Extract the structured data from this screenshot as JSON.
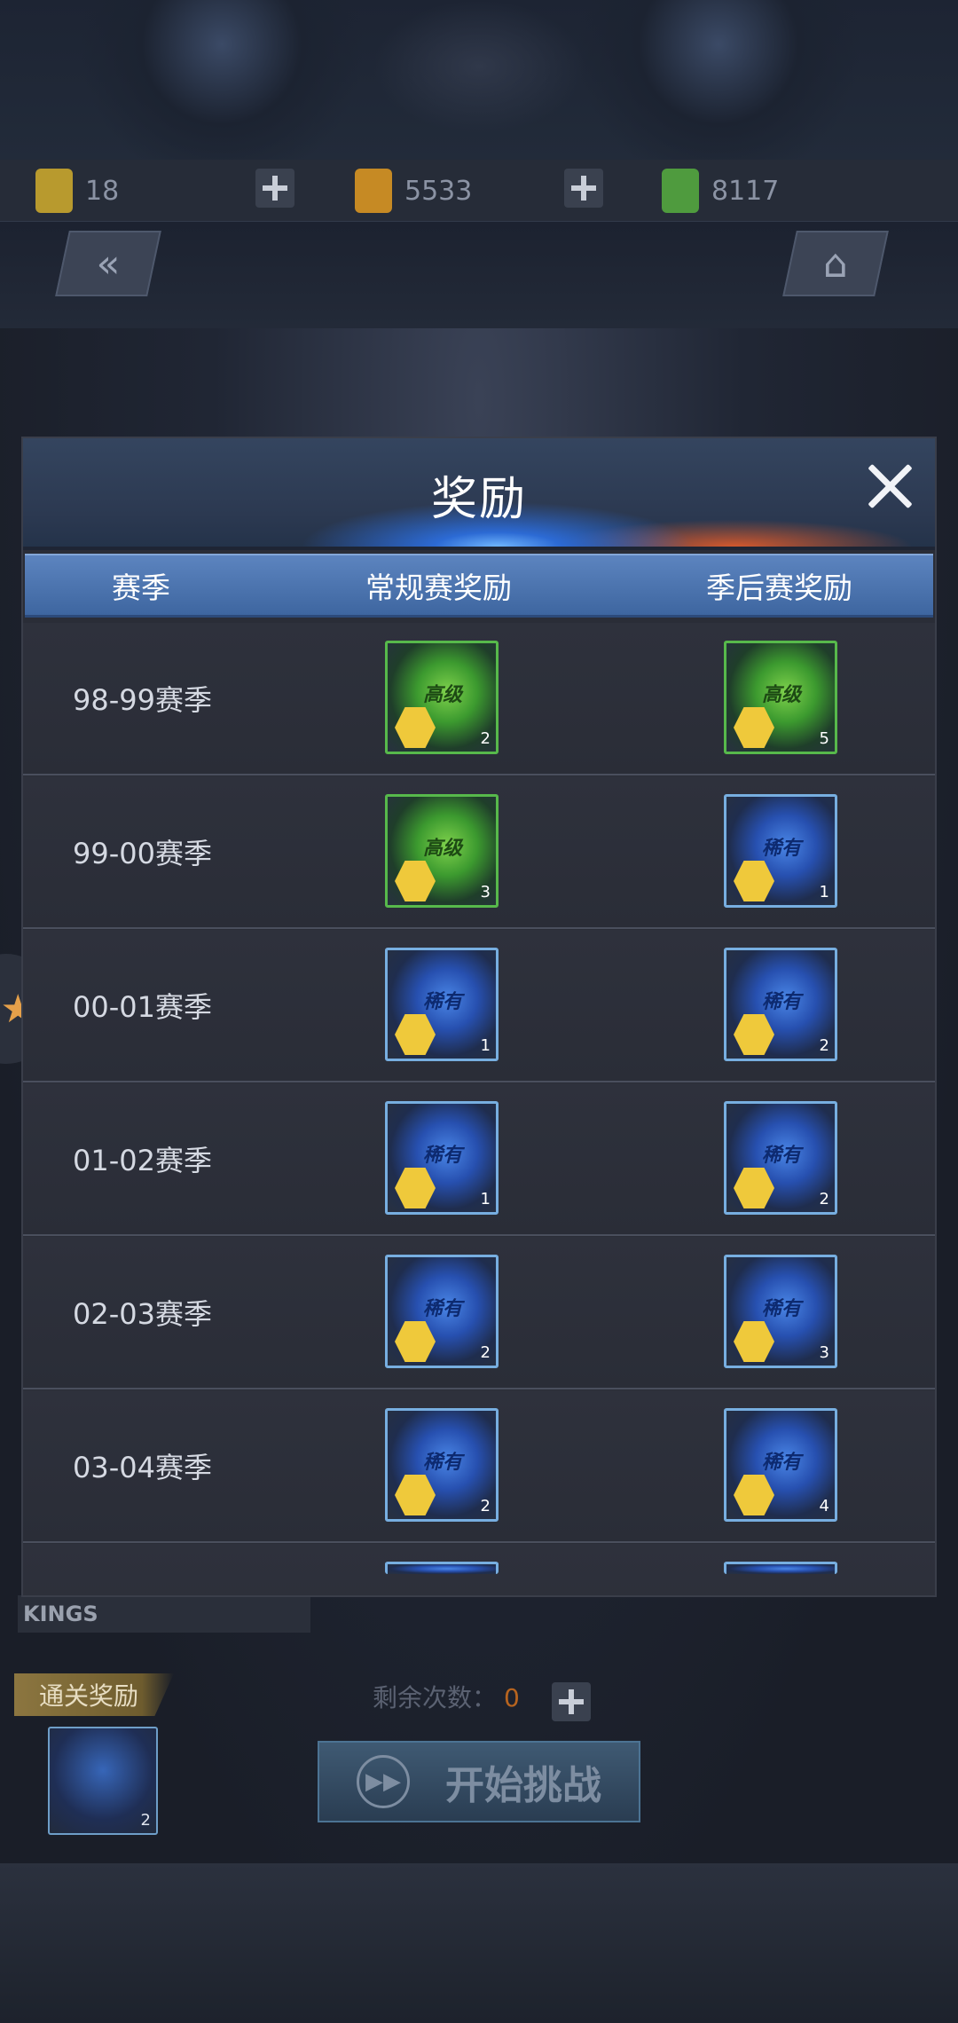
{
  "currency": {
    "tickets": "18",
    "gold": "5533",
    "green": "8117"
  },
  "lower": {
    "clear_reward_label": "通关奖励",
    "clear_reward_qty": "2",
    "clear_reward_egg": "稀有",
    "attempts_label": "剩余次数：",
    "attempts_value": "0",
    "start_label": "开始挑战",
    "team_text": "KINGS"
  },
  "modal": {
    "title": "奖励",
    "columns": [
      "赛季",
      "常规赛奖励",
      "季后赛奖励"
    ],
    "rows": [
      {
        "season": "98-99赛季",
        "regular": {
          "type": "green",
          "label": "高级",
          "qty": "2"
        },
        "playoff": {
          "type": "green",
          "label": "高级",
          "qty": "5"
        }
      },
      {
        "season": "99-00赛季",
        "regular": {
          "type": "green",
          "label": "高级",
          "qty": "3"
        },
        "playoff": {
          "type": "blue",
          "label": "稀有",
          "qty": "1"
        }
      },
      {
        "season": "00-01赛季",
        "regular": {
          "type": "blue",
          "label": "稀有",
          "qty": "1"
        },
        "playoff": {
          "type": "blue",
          "label": "稀有",
          "qty": "2"
        }
      },
      {
        "season": "01-02赛季",
        "regular": {
          "type": "blue",
          "label": "稀有",
          "qty": "1"
        },
        "playoff": {
          "type": "blue",
          "label": "稀有",
          "qty": "2"
        }
      },
      {
        "season": "02-03赛季",
        "regular": {
          "type": "blue",
          "label": "稀有",
          "qty": "2"
        },
        "playoff": {
          "type": "blue",
          "label": "稀有",
          "qty": "3"
        }
      },
      {
        "season": "03-04赛季",
        "regular": {
          "type": "blue",
          "label": "稀有",
          "qty": "2"
        },
        "playoff": {
          "type": "blue",
          "label": "稀有",
          "qty": "4"
        }
      }
    ]
  },
  "colors": {
    "header_blue": "#4f78b3",
    "green_frame": "#57b94b",
    "blue_frame": "#77aee0"
  },
  "icons": {
    "back": "double-chevron-left-icon",
    "home": "home-icon",
    "close": "close-icon",
    "plus": "plus-icon"
  }
}
